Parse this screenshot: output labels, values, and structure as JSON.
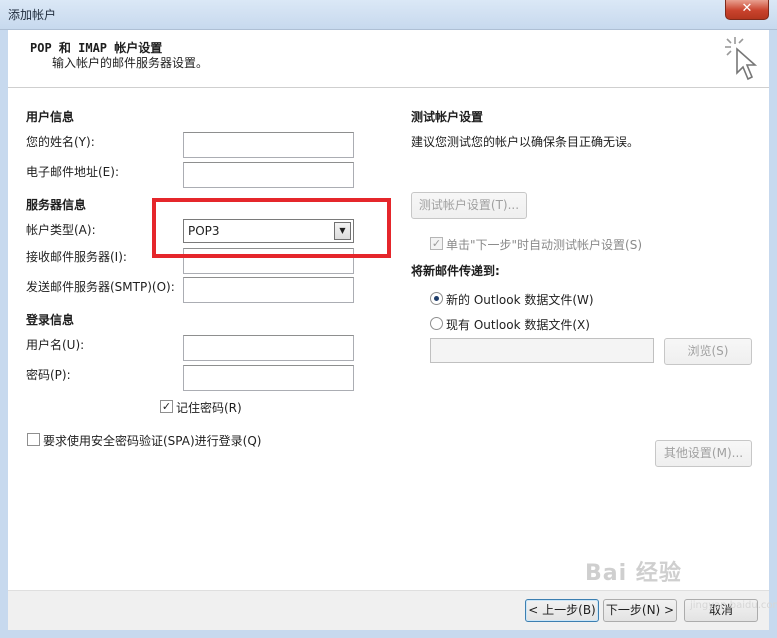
{
  "window": {
    "title": "添加帐户",
    "close_glyph": "✕"
  },
  "header": {
    "title": "POP 和 IMAP 帐户设置",
    "subtitle": "输入帐户的邮件服务器设置。",
    "icon": "cursor-sparkle-icon"
  },
  "user_info": {
    "heading": "用户信息",
    "name_label": "您的姓名(Y):",
    "email_label": "电子邮件地址(E):",
    "name_value": "",
    "email_value": ""
  },
  "server_info": {
    "heading": "服务器信息",
    "account_type_label": "帐户类型(A):",
    "account_type_value": "POP3",
    "incoming_label": "接收邮件服务器(I):",
    "outgoing_label": "发送邮件服务器(SMTP)(O):",
    "incoming_value": "",
    "outgoing_value": ""
  },
  "login_info": {
    "heading": "登录信息",
    "username_label": "用户名(U):",
    "password_label": "密码(P):",
    "username_value": "",
    "password_value": "",
    "remember_password_label": "记住密码(R)",
    "remember_password_checked": true
  },
  "spa": {
    "label": "要求使用安全密码验证(SPA)进行登录(Q)",
    "checked": false
  },
  "test_settings": {
    "heading": "测试帐户设置",
    "description": "建议您测试您的帐户以确保条目正确无误。",
    "test_button": "测试帐户设置(T)...",
    "auto_test_label": "单击\"下一步\"时自动测试帐户设置(S)",
    "auto_test_checked": true
  },
  "deliver_to": {
    "heading": "将新邮件传递到:",
    "new_file_label": "新的 Outlook 数据文件(W)",
    "existing_file_label": "现有 Outlook 数据文件(X)",
    "selected": "new",
    "path_value": "",
    "browse_button": "浏览(S)"
  },
  "more_settings_button": "其他设置(M)...",
  "footer": {
    "back_button": "< 上一步(B)",
    "next_button": "下一步(N) >",
    "cancel_button": "取消"
  },
  "watermark": {
    "text": "Bai 经验",
    "sub": "jingyan.baidu.com"
  },
  "colors": {
    "highlight": "#e5262b",
    "radio_dot": "#1f3d6a"
  }
}
